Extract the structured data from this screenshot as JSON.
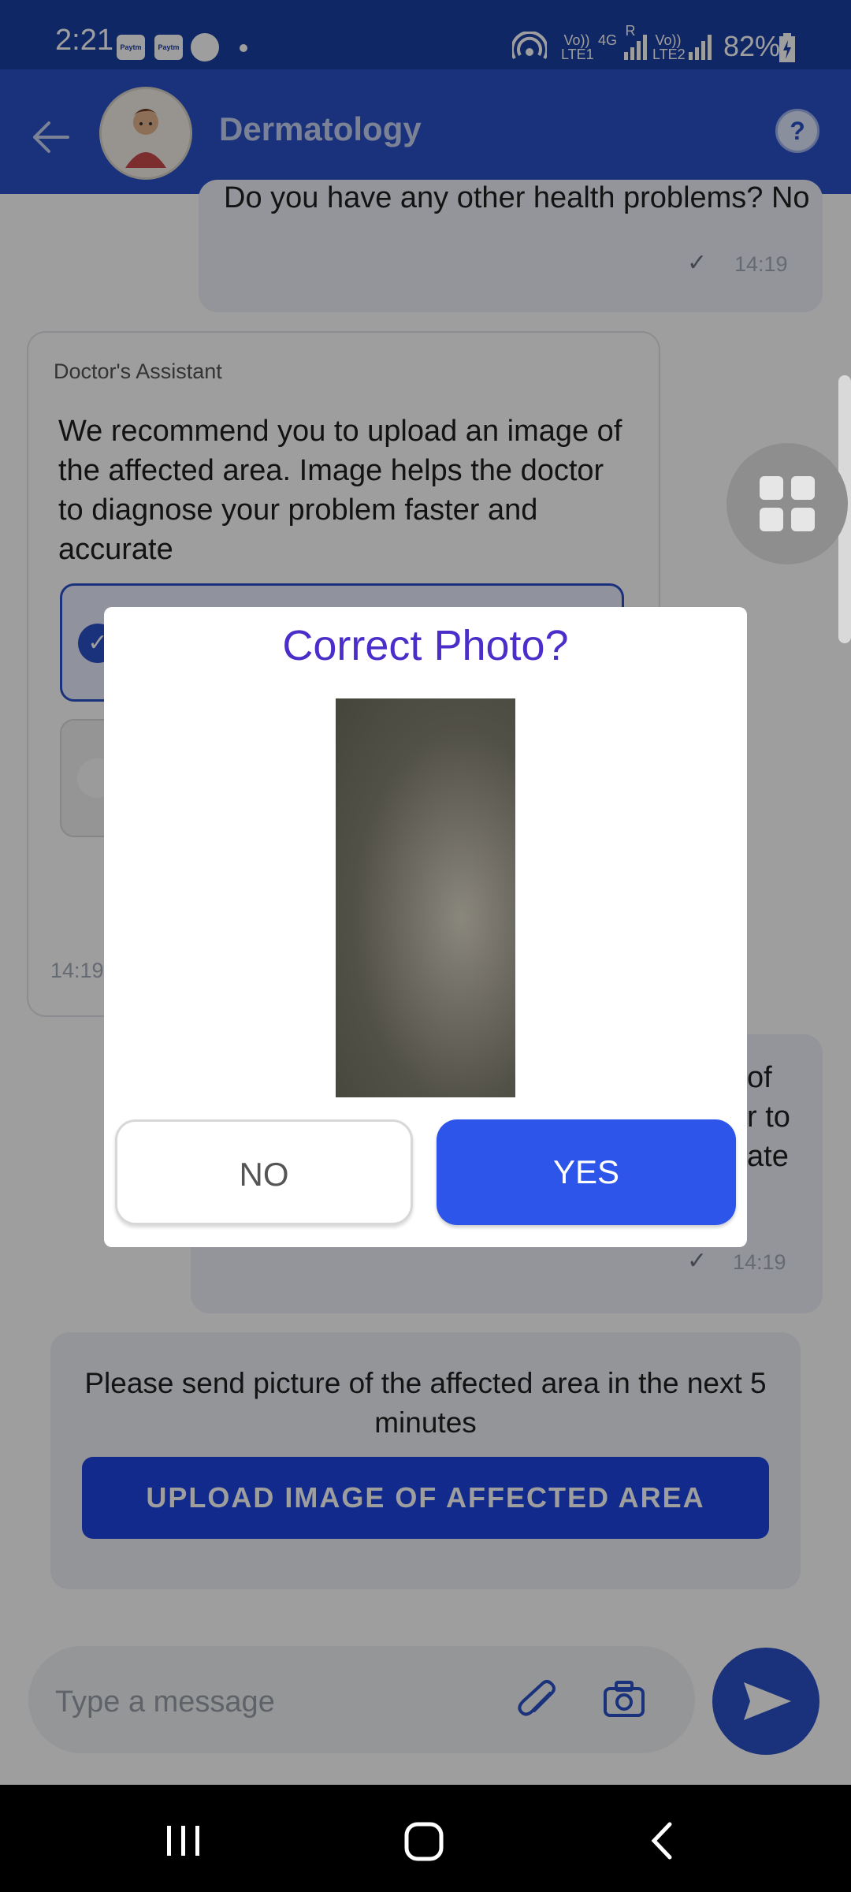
{
  "status_bar": {
    "time": "2:21",
    "app_badges": [
      "Paytm",
      "Paytm"
    ],
    "network_1": "Vo)) LTE1",
    "network_gen": "4G",
    "roaming": "R",
    "network_2": "Vo)) LTE2",
    "battery": "82%"
  },
  "header": {
    "title": "Dermatology",
    "help_label": "?"
  },
  "chat": {
    "prev_message": "Do you have any other health problems? No",
    "prev_time": "14:19",
    "assistant_label": "Doctor's Assistant",
    "assistant_message": "We recommend you to upload an image of the affected area. Image helps the doctor to diagnose your problem faster and accurate",
    "assistant_time": "14:19",
    "reply_fragments": [
      "of",
      "r to",
      "ate"
    ],
    "reply_time": "14:19"
  },
  "upload_card": {
    "text": "Please send picture of the affected area in the next 5 minutes",
    "button_label": "UPLOAD IMAGE OF AFFECTED AREA"
  },
  "composer": {
    "placeholder": "Type a message"
  },
  "dialog": {
    "title": "Correct Photo?",
    "no_label": "NO",
    "yes_label": "YES"
  },
  "colors": {
    "header_blue": "#2a52c9",
    "dialog_title": "#4b2ec9",
    "yes_button": "#2e55ea",
    "upload_button": "#1c45e0"
  }
}
